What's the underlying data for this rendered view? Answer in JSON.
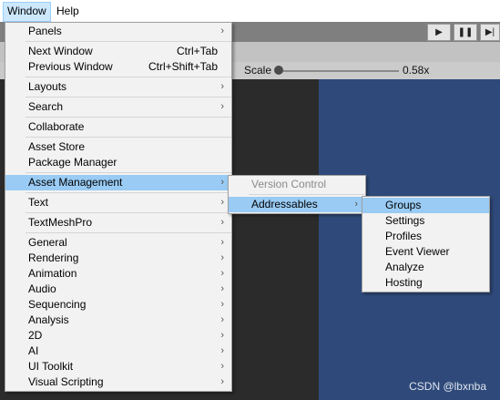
{
  "menubar": {
    "items": [
      {
        "label": "Window"
      },
      {
        "label": "Help"
      }
    ]
  },
  "scene_toolbar": {
    "scale_label": "Scale",
    "scale_value": "0.58x"
  },
  "window_menu": {
    "items": [
      {
        "label": "Panels",
        "submenu": true
      },
      {
        "label": "Next Window",
        "shortcut": "Ctrl+Tab"
      },
      {
        "label": "Previous Window",
        "shortcut": "Ctrl+Shift+Tab"
      },
      {
        "label": "Layouts",
        "submenu": true
      },
      {
        "label": "Search",
        "submenu": true
      },
      {
        "label": "Collaborate"
      },
      {
        "label": "Asset Store"
      },
      {
        "label": "Package Manager"
      },
      {
        "label": "Asset Management",
        "submenu": true
      },
      {
        "label": "Text",
        "submenu": true
      },
      {
        "label": "TextMeshPro",
        "submenu": true
      },
      {
        "label": "General",
        "submenu": true
      },
      {
        "label": "Rendering",
        "submenu": true
      },
      {
        "label": "Animation",
        "submenu": true
      },
      {
        "label": "Audio",
        "submenu": true
      },
      {
        "label": "Sequencing",
        "submenu": true
      },
      {
        "label": "Analysis",
        "submenu": true
      },
      {
        "label": "2D",
        "submenu": true
      },
      {
        "label": "AI",
        "submenu": true
      },
      {
        "label": "UI Toolkit",
        "submenu": true
      },
      {
        "label": "Visual Scripting",
        "submenu": true
      }
    ]
  },
  "asset_management_menu": {
    "items": [
      {
        "label": "Version Control"
      },
      {
        "label": "Addressables"
      }
    ]
  },
  "addressables_menu": {
    "items": [
      {
        "label": "Groups"
      },
      {
        "label": "Settings"
      },
      {
        "label": "Profiles"
      },
      {
        "label": "Event Viewer"
      },
      {
        "label": "Analyze"
      },
      {
        "label": "Hosting"
      }
    ]
  },
  "watermark": "CSDN @lbxnba",
  "colors": {
    "highlight": "#99cbf4",
    "menu_bg": "#f2f2f2",
    "scene_blue": "#2f4a7a"
  }
}
